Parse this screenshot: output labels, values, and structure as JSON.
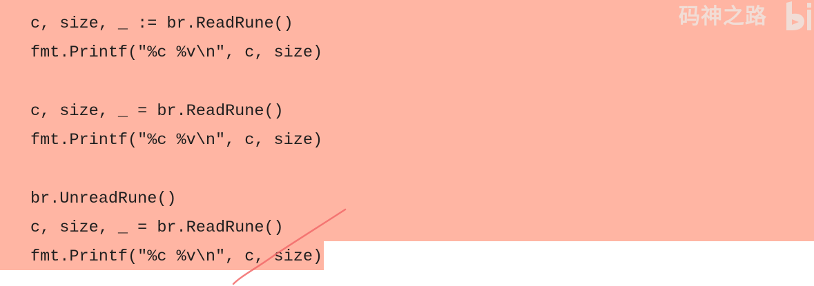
{
  "code_lines": [
    "c, size, _ := br.ReadRune()",
    "fmt.Printf(\"%c %v\\n\", c, size)",
    "",
    "c, size, _ = br.ReadRune()",
    "fmt.Printf(\"%c %v\\n\", c, size)",
    "",
    "br.UnreadRune()",
    "c, size, _ = br.ReadRune()",
    "fmt.Printf(\"%c %v\\n\", c, size)"
  ],
  "watermark": {
    "text": "码神之路",
    "logo": "bilibili-logo"
  },
  "colors": {
    "highlight": "#ffb5a3",
    "text": "#1e1e1e",
    "pen_stroke": "#f26a6a"
  }
}
